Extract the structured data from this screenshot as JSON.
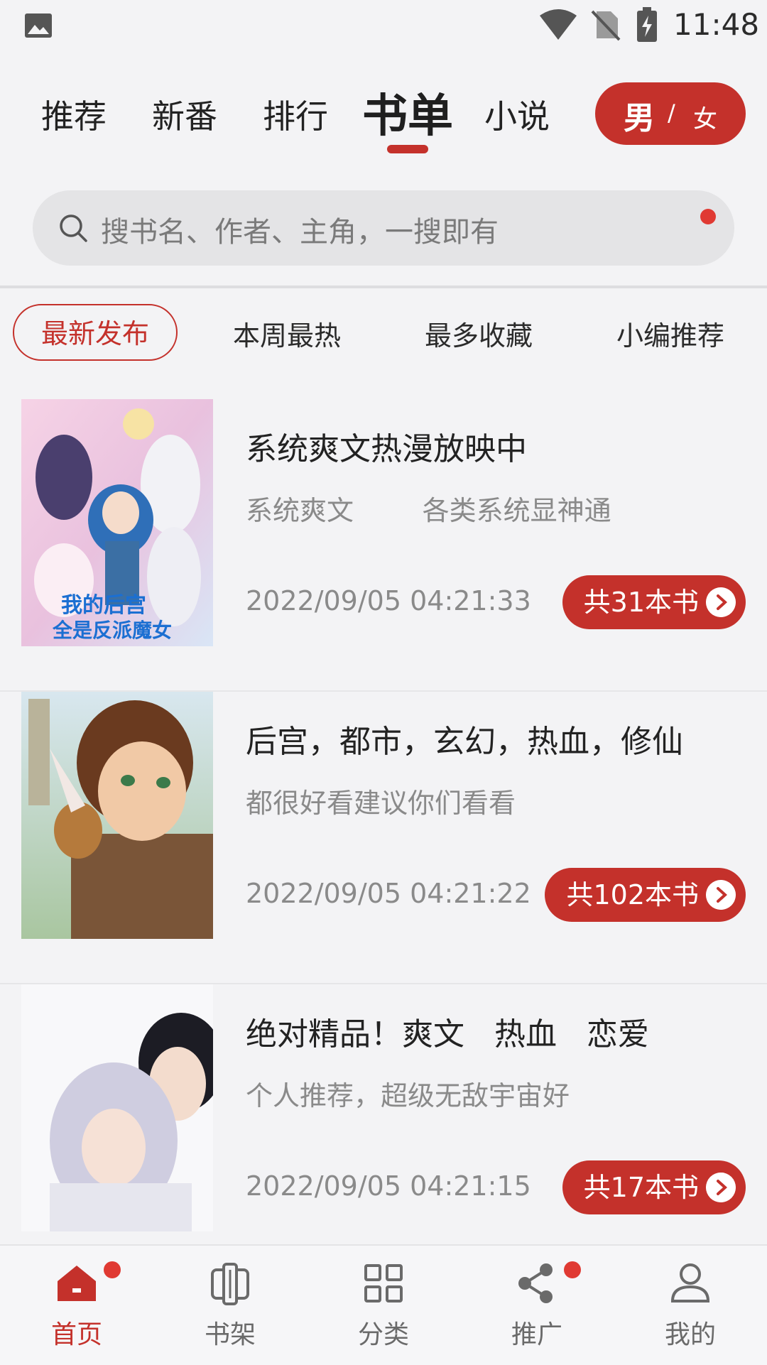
{
  "status_bar": {
    "time": "11:48"
  },
  "top_tabs": [
    {
      "label": "推荐"
    },
    {
      "label": "新番"
    },
    {
      "label": "排行"
    },
    {
      "label": "书单",
      "active": true
    },
    {
      "label": "小说"
    }
  ],
  "gender_toggle": {
    "male": "男",
    "separator": "/",
    "female": "女"
  },
  "search": {
    "placeholder": "搜书名、作者、主角，一搜即有"
  },
  "filters": [
    {
      "label": "最新发布",
      "active": true
    },
    {
      "label": "本周最热"
    },
    {
      "label": "最多收藏"
    },
    {
      "label": "小编推荐"
    }
  ],
  "booklists": [
    {
      "title": "系统爽文热漫放映中",
      "tags": "系统爽文        各类系统显神通",
      "date": "2022/09/05 04:21:33",
      "count": "共31本书",
      "cover_text_1": "我的后宫",
      "cover_text_2": "全是反派魔女"
    },
    {
      "title": "后宫，都市，玄幻，热血，修仙",
      "tags": "都很好看建议你们看看",
      "date": "2022/09/05 04:21:22",
      "count": "共102本书"
    },
    {
      "title": "绝对精品！爽文   热血   恋爱",
      "tags": "个人推荐，超级无敌宇宙好",
      "date": "2022/09/05 04:21:15",
      "count": "共17本书"
    }
  ],
  "bottom_nav": [
    {
      "label": "首页",
      "active": true,
      "badge": true
    },
    {
      "label": "书架"
    },
    {
      "label": "分类"
    },
    {
      "label": "推广",
      "badge": true
    },
    {
      "label": "我的"
    }
  ],
  "colors": {
    "accent": "#c4312b",
    "badge": "#e03a33"
  }
}
